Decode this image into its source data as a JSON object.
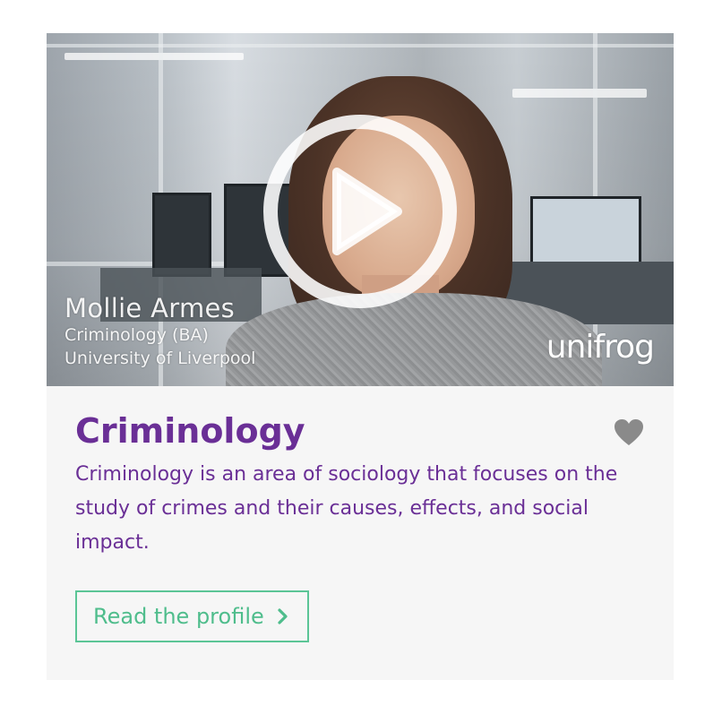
{
  "video": {
    "speaker_name": "Mollie Armes",
    "speaker_course": "Criminology (BA)",
    "speaker_university": "University of Liverpool",
    "brand": "unifrog",
    "play_icon": "play-icon"
  },
  "card": {
    "title": "Criminology",
    "favorite_icon": "heart-icon",
    "description": "Criminology is an area of sociology that focuses on the study of crimes and their causes, effects, and social impact.",
    "cta_label": "Read the profile",
    "cta_icon": "chevron-right-icon"
  },
  "colors": {
    "title": "#6a2f96",
    "cta": "#4fbd8c",
    "card_background": "#f6f6f6",
    "heart": "#8a8a8a"
  }
}
